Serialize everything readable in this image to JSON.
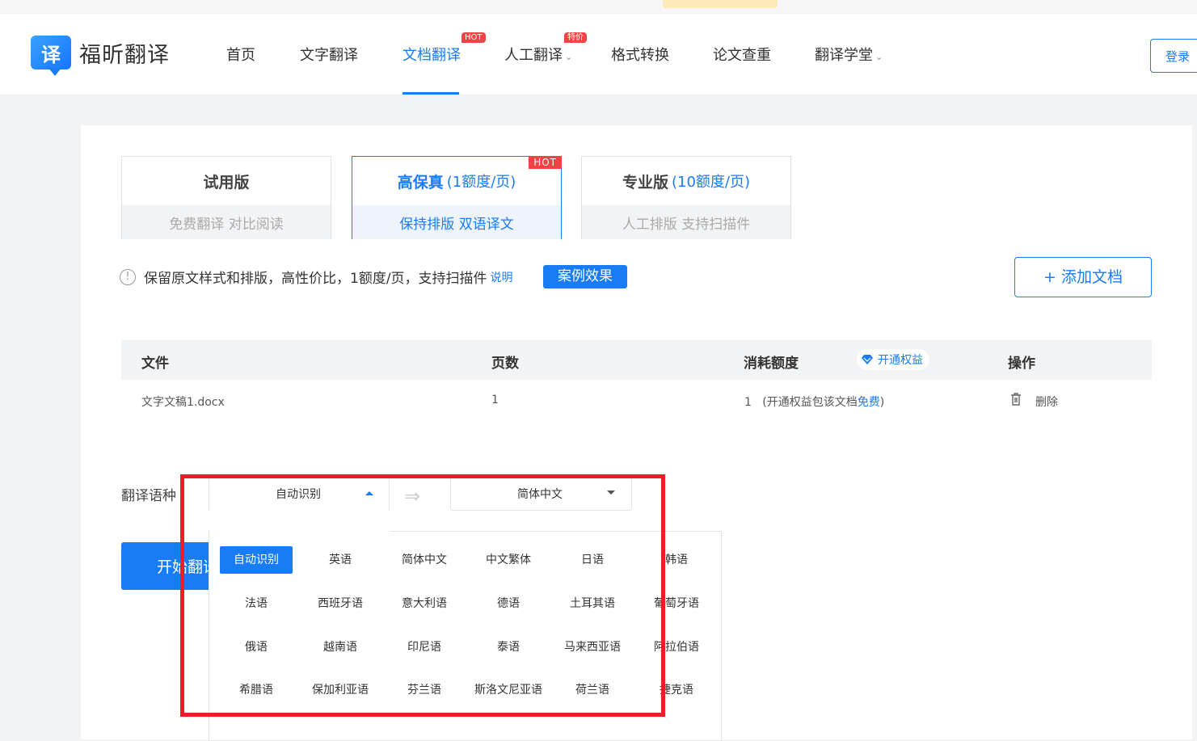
{
  "brand": {
    "name": "福昕翻译",
    "icon_char": "译",
    "accent": "#1a7cf5"
  },
  "nav": {
    "items": [
      "首页",
      "文字翻译",
      "文档翻译",
      "人工翻译",
      "格式转换",
      "论文查重",
      "翻译学堂"
    ],
    "active": "文档翻译",
    "badges": {
      "hot": "HOT",
      "special": "特价"
    }
  },
  "login": "登录",
  "plans": [
    {
      "name": "试用版",
      "price": "",
      "desc": "免费翻译  对比阅读"
    },
    {
      "name": "高保真",
      "price": "(1额度/页)",
      "desc": "保持排版  双语译文",
      "tag": "HOT"
    },
    {
      "name": "专业版",
      "price": "(10额度/页)",
      "desc": "人工排版  支持扫描件"
    }
  ],
  "info": {
    "text": "保留原文样式和排版，高性价比，1额度/页，支持扫描件",
    "link": "说明",
    "case_button": "案例效果"
  },
  "add_doc": "+ 添加文档",
  "table": {
    "headers": {
      "file": "文件",
      "pages": "页数",
      "cost": "消耗额度",
      "perk": "开通权益",
      "ops": "操作"
    },
    "rows": [
      {
        "file": "文字文稿1.docx",
        "pages": "1",
        "cost_num": "1",
        "cost_note_a": "(开通权益包该文档",
        "cost_note_free": "免费",
        "cost_note_b": ")",
        "delete": "删除"
      }
    ]
  },
  "translate": {
    "label": "翻译语种",
    "source": "自动识别",
    "target": "简体中文",
    "start_button": "开始翻译"
  },
  "languages": [
    [
      "自动识别",
      "英语",
      "简体中文",
      "中文繁体",
      "日语",
      "韩语"
    ],
    [
      "法语",
      "西班牙语",
      "意大利语",
      "德语",
      "土耳其语",
      "葡萄牙语"
    ],
    [
      "俄语",
      "越南语",
      "印尼语",
      "泰语",
      "马来西亚语",
      "阿拉伯语"
    ],
    [
      "希腊语",
      "保加利亚语",
      "芬兰语",
      "斯洛文尼亚语",
      "荷兰语",
      "捷克语"
    ]
  ],
  "highlight_color": "#ee1c25"
}
